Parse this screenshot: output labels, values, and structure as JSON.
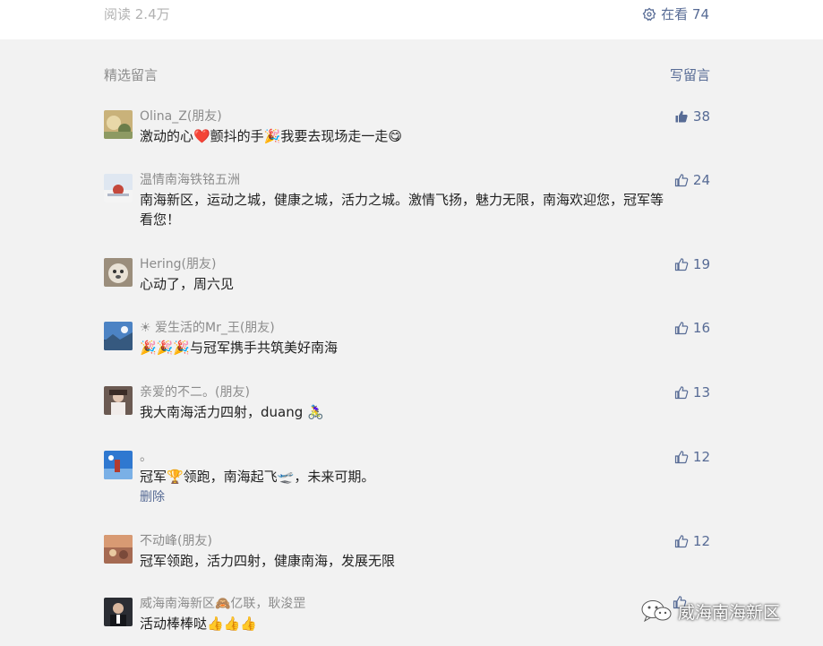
{
  "stats": {
    "read_label": "阅读 2.4万",
    "watching_label": "在看 74"
  },
  "comments_section": {
    "title": "精选留言",
    "write_label": "写留言"
  },
  "comments": [
    {
      "nickname": "Olina_Z(朋友)",
      "text": "激动的心❤️颤抖的手🎉我要去现场走一走😋",
      "likes": "38",
      "liked": true
    },
    {
      "nickname": "温情南海铁铭五洲",
      "text": "南海新区，运动之城，健康之城，活力之城。激情飞扬，魅力无限，南海欢迎您，冠军等看您！",
      "likes": "24",
      "liked": false
    },
    {
      "nickname": "Hering(朋友)",
      "text": "心动了，周六见",
      "likes": "19",
      "liked": false
    },
    {
      "nickname": "☀ 爱生活的Mr_王(朋友)",
      "text": "🎉🎉🎉与冠军携手共筑美好南海",
      "likes": "16",
      "liked": false
    },
    {
      "nickname": "亲爱的不二。(朋友)",
      "text": "我大南海活力四射，duang 🚴‍♀️",
      "likes": "13",
      "liked": false
    },
    {
      "nickname": "。",
      "text": "冠军🏆领跑，南海起飞🛫，未来可期。",
      "delete_label": "删除",
      "likes": "12",
      "liked": false
    },
    {
      "nickname": "不动峰(朋友)",
      "text": "冠军领跑，活力四射，健康南海，发展无限",
      "likes": "12",
      "liked": false
    },
    {
      "nickname": "威海南海新区🙈亿联，耿浚罡",
      "text": "活动棒棒哒👍👍👍",
      "likes": "",
      "liked": false
    }
  ],
  "watermark": {
    "text": "威海南海新区"
  },
  "colors": {
    "link": "#576b95",
    "muted": "#8c8c8c",
    "background": "#f2f2f2"
  }
}
